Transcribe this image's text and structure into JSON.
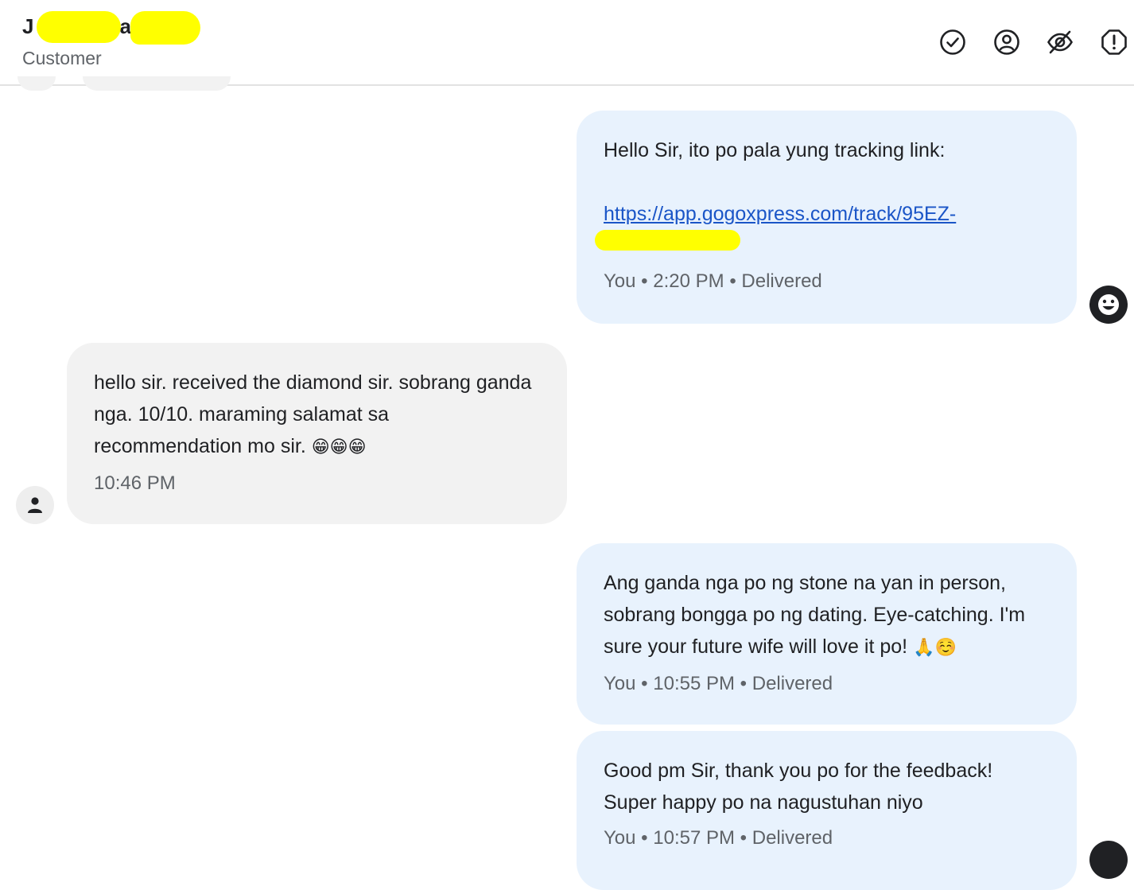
{
  "header": {
    "contact_name": "J",
    "contact_name_partial": "a",
    "contact_role": "Customer",
    "actions": [
      {
        "icon": "check-circle-icon"
      },
      {
        "icon": "account-circle-icon"
      },
      {
        "icon": "eye-off-icon"
      },
      {
        "icon": "report-octagon-icon"
      }
    ]
  },
  "messages": [
    {
      "direction": "outgoing",
      "text": "Hello Sir, ito po pala yung tracking link:",
      "link": "https://app.gogoxpress.com/track/95EZ-",
      "sender": "You",
      "time": "2:20 PM",
      "status": "Delivered",
      "sep": "•"
    },
    {
      "direction": "incoming",
      "text": "hello sir. received the diamond sir. sobrang ganda nga. 10/10. maraming salamat sa recommendation mo sir.",
      "emoji": "😁😁😁",
      "time": "10:46 PM"
    },
    {
      "direction": "outgoing",
      "text": "Ang ganda nga po ng stone na yan in person, sobrang bongga po ng dating. Eye-catching. I'm sure your future wife will love it po!",
      "emoji": "🙏☺️",
      "sender": "You",
      "time": "10:55 PM",
      "status": "Delivered",
      "sep": "•"
    },
    {
      "direction": "outgoing",
      "text": "Good pm Sir, thank you po for the feedback! Super happy po na nagustuhan niyo",
      "sender": "You",
      "time": "10:57 PM",
      "status": "Delivered",
      "sep": "•"
    }
  ],
  "colors": {
    "outgoing_bubble": "#e8f2fd",
    "incoming_bubble": "#f2f2f2",
    "link": "#1a55c7",
    "redaction": "#ffff00"
  }
}
